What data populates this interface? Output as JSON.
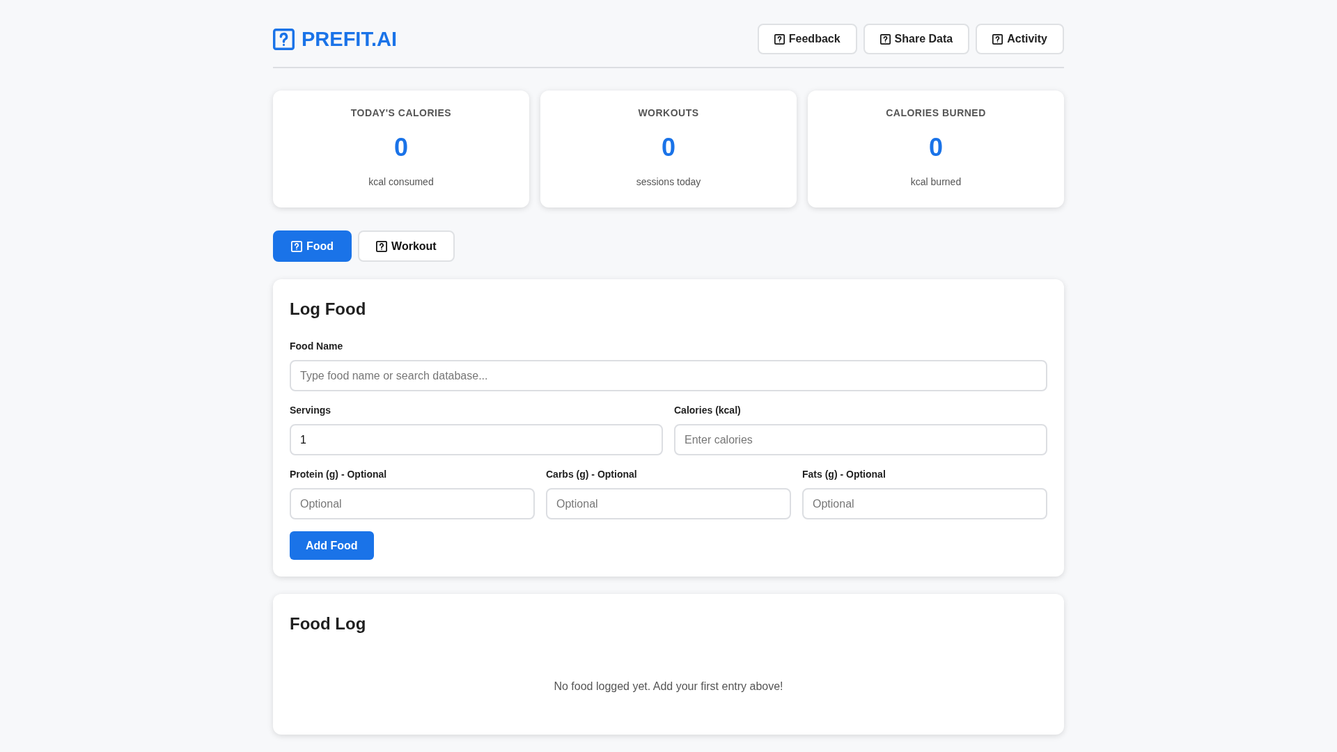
{
  "header": {
    "logo": "PREFIT.AI",
    "buttons": [
      {
        "label": "Feedback"
      },
      {
        "label": "Share Data"
      },
      {
        "label": "Activity"
      }
    ]
  },
  "stats": [
    {
      "title": "TODAY'S CALORIES",
      "value": "0",
      "caption": "kcal consumed"
    },
    {
      "title": "WORKOUTS",
      "value": "0",
      "caption": "sessions today"
    },
    {
      "title": "CALORIES BURNED",
      "value": "0",
      "caption": "kcal burned"
    }
  ],
  "tabs": [
    {
      "label": "Food",
      "selected": true
    },
    {
      "label": "Workout",
      "selected": false
    }
  ],
  "log_form": {
    "title": "Log Food",
    "rows": [
      [
        {
          "label": "Food Name",
          "placeholder": "Type food name or search database..."
        }
      ],
      [
        {
          "label": "Servings",
          "value": "1"
        },
        {
          "label": "Calories (kcal)",
          "placeholder": "Enter calories"
        }
      ],
      [
        {
          "label": "Protein (g) - Optional",
          "placeholder": "Optional"
        },
        {
          "label": "Carbs (g) - Optional",
          "placeholder": "Optional"
        },
        {
          "label": "Fats (g) - Optional",
          "placeholder": "Optional"
        }
      ]
    ],
    "submit": "Add Food"
  },
  "food_log": {
    "title": "Food Log",
    "empty_message": "No food logged yet. Add your first entry above!"
  }
}
